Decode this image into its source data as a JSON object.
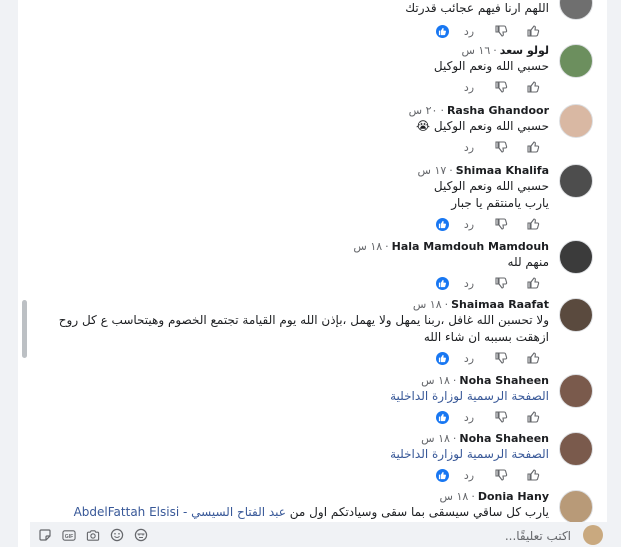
{
  "labels": {
    "reply": "رد"
  },
  "comments": [
    {
      "name": "",
      "time": "",
      "text": "اللهم ارنا فيهم عجائب قدرتك",
      "liked": true,
      "avatar_color": "#6f6f6f"
    },
    {
      "name": "لولو سعد",
      "time": "١٦ س",
      "text": "حسبي الله ونعم الوكيل",
      "liked": false,
      "avatar_color": "#6c8f5e"
    },
    {
      "name": "Rasha Ghandoor",
      "time": "٢٠ س",
      "text": "حسبي الله ونعم الوكيل 😭",
      "liked": false,
      "avatar_color": "#d9b8a3"
    },
    {
      "name": "Shimaa Khalifa",
      "time": "١٧ س",
      "text": "حسبي الله ونعم الوكيل",
      "text2": "يارب يامنتقم يا جبار",
      "liked": true,
      "avatar_color": "#4d4d4d"
    },
    {
      "name": "Hala Mamdouh Mamdouh",
      "time": "١٨ س",
      "text": "منهم لله",
      "liked": true,
      "avatar_color": "#3b3b3b"
    },
    {
      "name": "Shaimaa Raafat",
      "time": "١٨ س",
      "text": "ولا تحسبن الله غافل ،ربنا يمهل ولا يهمل ،بإذن الله يوم القيامة تجتمع الخصوم وهيتحاسب ع كل روح",
      "text2": "ازهقت بسببه ان شاء الله",
      "liked": true,
      "avatar_color": "#5a4a3e"
    },
    {
      "name": "Noha Shaheen",
      "time": "١٨ س",
      "text": "الصفحة الرسمية لوزارة الداخلية",
      "liked": true,
      "avatar_color": "#7a5a4c"
    },
    {
      "name": "Noha Shaheen",
      "time": "١٨ س",
      "text": "الصفحة الرسمية لوزارة الداخلية",
      "liked": true,
      "avatar_color": "#7a5a4c"
    },
    {
      "name": "Donia Hany",
      "time": "١٨ س",
      "text_prefix": "يارب كل ساقي سيسقى بما سقى وسيادتكم اول من",
      "text_link": "عبد الفتاح السيسي - AbdelFattah Elsisi",
      "avatar_color": "#b89a78"
    }
  ],
  "composer": {
    "placeholder": "اكتب تعليقًا...",
    "tools": [
      "sticker-icon",
      "gif-icon",
      "camera-icon",
      "emoji-icon",
      "avatar-sticker-icon"
    ]
  },
  "colors": {
    "accent": "#1877f2",
    "link": "#385898",
    "muted": "#65676b"
  }
}
